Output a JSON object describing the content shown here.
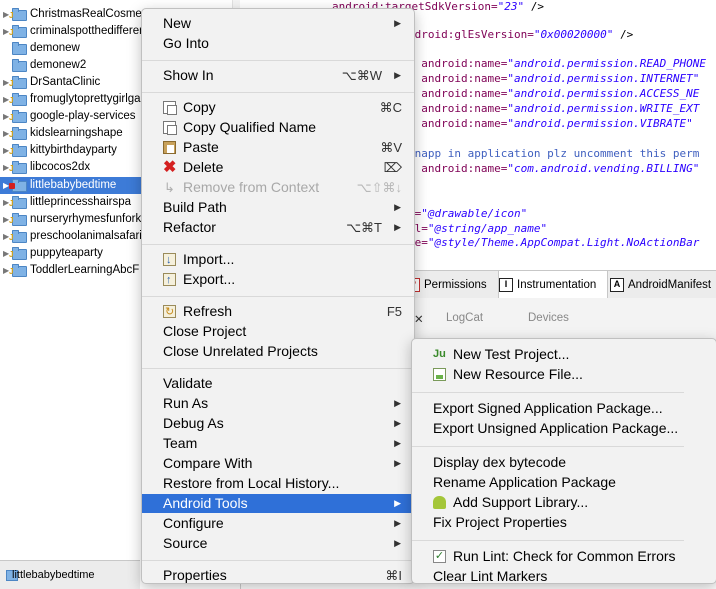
{
  "explorer": {
    "items": [
      {
        "label": "ChristmasRealCosmet",
        "icon": "project-j"
      },
      {
        "label": "criminalspotthedifferen",
        "icon": "project-j"
      },
      {
        "label": "demonew",
        "icon": "folder"
      },
      {
        "label": "demonew2",
        "icon": "folder"
      },
      {
        "label": "DrSantaClinic",
        "icon": "project-j"
      },
      {
        "label": "fromuglytoprettygirlga",
        "icon": "project-j"
      },
      {
        "label": "google-play-services",
        "icon": "project-j"
      },
      {
        "label": "kidslearningshape",
        "icon": "project-j"
      },
      {
        "label": "kittybirthdayparty",
        "icon": "project-j"
      },
      {
        "label": "libcocos2dx",
        "icon": "project-j"
      },
      {
        "label": "littlebabybedtime",
        "icon": "project-error",
        "selected": true
      },
      {
        "label": "littleprincesshairspa",
        "icon": "project-j"
      },
      {
        "label": "nurseryrhymesfunfork",
        "icon": "project-j"
      },
      {
        "label": "preschoolanimalsafari",
        "icon": "project-j"
      },
      {
        "label": "puppyteaparty",
        "icon": "project-j"
      },
      {
        "label": "ToddlerLearningAbcF",
        "icon": "project-j"
      }
    ],
    "status_label": "littlebabybedtime"
  },
  "editor": {
    "lines": [
      {
        "parts": [
          [
            "attr",
            "android:targetSdkVersion="
          ],
          [
            "str",
            "\"23\""
          ],
          [
            "plain",
            " />"
          ]
        ]
      },
      {
        "parts": [
          [
            "attr",
            "ndroid:glEsVersion="
          ],
          [
            "str",
            "\"0x00020000\""
          ],
          [
            "plain",
            " />"
          ]
        ]
      },
      {
        "parts": [
          [
            "attr",
            "n android:name="
          ],
          [
            "str",
            "\"android.permission.READ_PHONE"
          ]
        ]
      },
      {
        "parts": [
          [
            "attr",
            "n android:name="
          ],
          [
            "str",
            "\"android.permission.INTERNET\""
          ]
        ]
      },
      {
        "parts": [
          [
            "attr",
            "n android:name="
          ],
          [
            "str",
            "\"android.permission.ACCESS_NE"
          ]
        ]
      },
      {
        "parts": [
          [
            "attr",
            "n android:name="
          ],
          [
            "str",
            "\"android.permission.WRITE_EXT"
          ]
        ]
      },
      {
        "parts": [
          [
            "attr",
            "n android:name="
          ],
          [
            "str",
            "\"android.permission.VIBRATE\""
          ]
        ]
      },
      {
        "parts": [
          [
            "cmt",
            "inapp in application plz uncomment this perm"
          ]
        ]
      },
      {
        "parts": [
          [
            "attr",
            "n android:name="
          ],
          [
            "str",
            "\"com.android.vending.BILLING\""
          ]
        ]
      },
      {
        "parts": [
          [
            "attr",
            "n="
          ],
          [
            "str",
            "\"@drawable/icon\""
          ]
        ]
      },
      {
        "parts": [
          [
            "attr",
            "el="
          ],
          [
            "str",
            "\"@string/app_name\""
          ]
        ]
      },
      {
        "parts": [
          [
            "attr",
            "me="
          ],
          [
            "str",
            "\"@style/Theme.AppCompat.Light.NoActionBar"
          ]
        ]
      }
    ],
    "tabs": [
      "Permissions",
      "Instrumentation",
      "AndroidManifest"
    ],
    "tab_icons": [
      "P",
      "I",
      "A"
    ],
    "views": [
      "LogCat",
      "Devices"
    ]
  },
  "context_menu": {
    "items": [
      {
        "label": "New",
        "submenu": true
      },
      {
        "label": "Go Into"
      },
      {
        "sep": true
      },
      {
        "label": "Show In",
        "shortcut": "⌥⌘W",
        "submenu": true
      },
      {
        "sep": true
      },
      {
        "label": "Copy",
        "shortcut": "⌘C",
        "icon": "copy-icon"
      },
      {
        "label": "Copy Qualified Name",
        "icon": "copy-qualified-icon"
      },
      {
        "label": "Paste",
        "shortcut": "⌘V",
        "icon": "paste-icon"
      },
      {
        "label": "Delete",
        "shortcut": "⌦",
        "icon": "delete-icon"
      },
      {
        "label": "Remove from Context",
        "shortcut": "⌥⇧⌘↓",
        "icon": "remove-context-icon",
        "disabled": true
      },
      {
        "label": "Build Path",
        "submenu": true
      },
      {
        "label": "Refactor",
        "shortcut": "⌥⌘T",
        "submenu": true
      },
      {
        "sep": true
      },
      {
        "label": "Import...",
        "icon": "import-icon"
      },
      {
        "label": "Export...",
        "icon": "export-icon"
      },
      {
        "sep": true
      },
      {
        "label": "Refresh",
        "shortcut": "F5",
        "icon": "refresh-icon"
      },
      {
        "label": "Close Project"
      },
      {
        "label": "Close Unrelated Projects"
      },
      {
        "sep": true
      },
      {
        "label": "Validate"
      },
      {
        "label": "Run As",
        "submenu": true
      },
      {
        "label": "Debug As",
        "submenu": true
      },
      {
        "label": "Team",
        "submenu": true
      },
      {
        "label": "Compare With",
        "submenu": true
      },
      {
        "label": "Restore from Local History..."
      },
      {
        "label": "Android Tools",
        "submenu": true,
        "highlighted": true
      },
      {
        "label": "Configure",
        "submenu": true
      },
      {
        "label": "Source",
        "submenu": true
      },
      {
        "sep": true
      },
      {
        "label": "Properties",
        "shortcut": "⌘I"
      }
    ]
  },
  "android_tools_menu": {
    "items": [
      {
        "label": "New Test Project...",
        "icon": "junit-icon"
      },
      {
        "label": "New Resource File...",
        "icon": "resource-file-icon"
      },
      {
        "sep": true
      },
      {
        "label": "Export Signed Application Package..."
      },
      {
        "label": "Export Unsigned Application Package..."
      },
      {
        "sep": true
      },
      {
        "label": "Display dex bytecode"
      },
      {
        "label": "Rename Application Package"
      },
      {
        "label": "Add Support Library...",
        "icon": "android-icon"
      },
      {
        "label": "Fix Project Properties"
      },
      {
        "sep": true
      },
      {
        "label": "Run Lint: Check for Common Errors",
        "icon": "lint-check-icon"
      },
      {
        "label": "Clear Lint Markers"
      }
    ]
  },
  "glyphs": {
    "submenu_arrow": "▶",
    "tree_arrow": "▶",
    "close_x": "✕"
  },
  "colors": {
    "selection": "#3d7bd7",
    "menu_highlight": "#2f70d8"
  }
}
